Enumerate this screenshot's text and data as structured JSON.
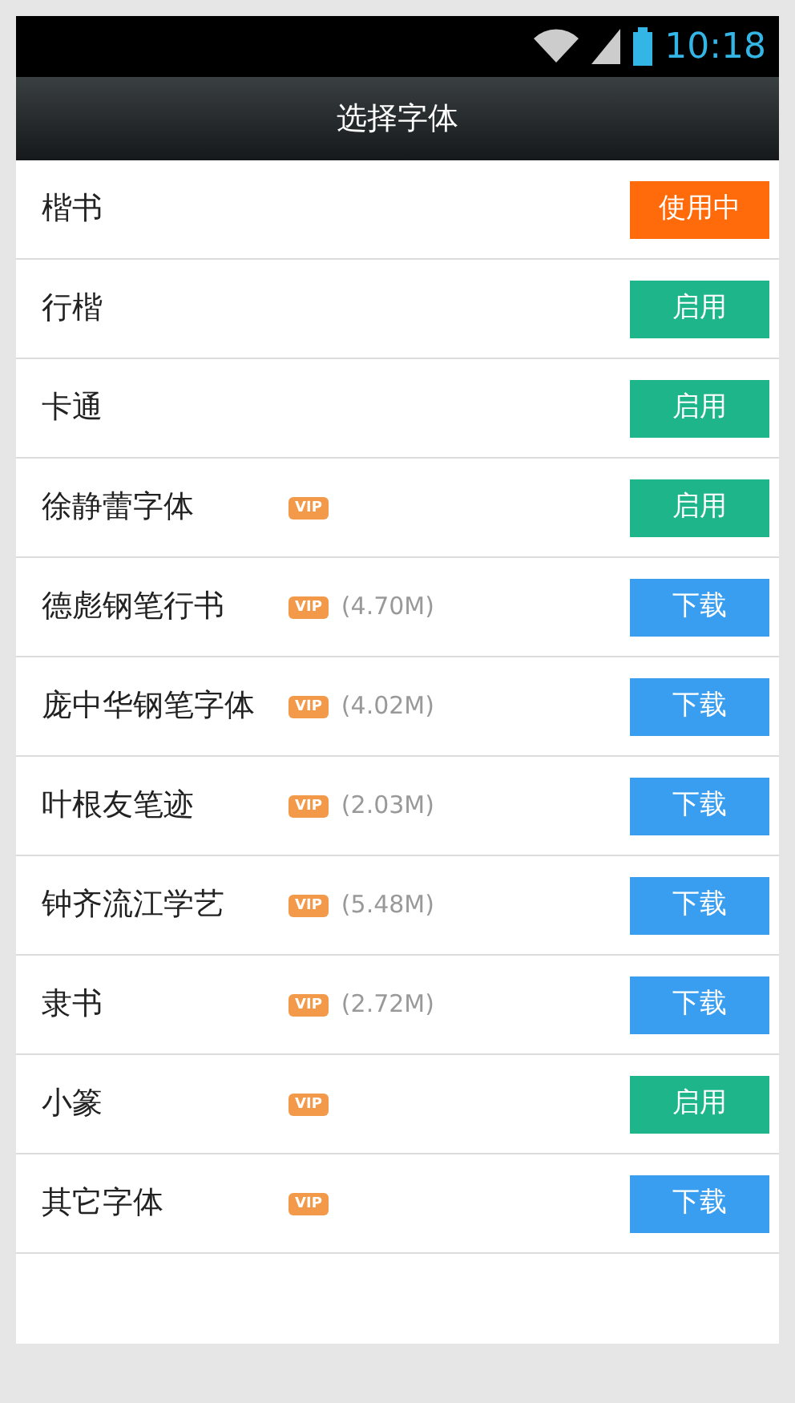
{
  "status_bar": {
    "time": "10:18"
  },
  "title": "选择字体",
  "fonts": [
    {
      "name": "楷书",
      "button": {
        "kind": "in_use",
        "label": "使用中"
      }
    },
    {
      "name": "行楷",
      "button": {
        "kind": "enable",
        "label": "启用"
      }
    },
    {
      "name": "卡通",
      "button": {
        "kind": "enable",
        "label": "启用"
      }
    },
    {
      "name": "徐静蕾字体",
      "badge": "VIP",
      "button": {
        "kind": "enable",
        "label": "启用"
      }
    },
    {
      "name": "德彪钢笔行书",
      "badge": "VIP",
      "size": "(4.70M)",
      "button": {
        "kind": "download",
        "label": "下载"
      }
    },
    {
      "name": "庞中华钢笔字体",
      "badge": "VIP",
      "size": "(4.02M)",
      "button": {
        "kind": "download",
        "label": "下载"
      }
    },
    {
      "name": "叶根友笔迹",
      "badge": "VIP",
      "size": "(2.03M)",
      "button": {
        "kind": "download",
        "label": "下载"
      }
    },
    {
      "name": "钟齐流江学艺",
      "badge": "VIP",
      "size": "(5.48M)",
      "button": {
        "kind": "download",
        "label": "下载"
      }
    },
    {
      "name": "隶书",
      "badge": "VIP",
      "size": "(2.72M)",
      "button": {
        "kind": "download",
        "label": "下载"
      }
    },
    {
      "name": "小篆",
      "badge": "VIP",
      "button": {
        "kind": "enable",
        "label": "启用"
      }
    },
    {
      "name": "其它字体",
      "badge": "VIP",
      "button": {
        "kind": "download",
        "label": "下载"
      }
    }
  ]
}
